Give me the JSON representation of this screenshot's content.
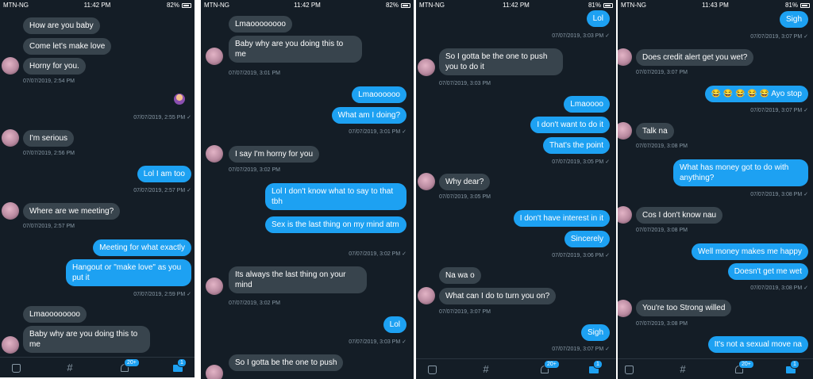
{
  "status_bars": [
    {
      "carrier": "MTN-NG",
      "time": "11:42 PM",
      "battery": "82%"
    },
    {
      "carrier": "MTN-NG",
      "time": "11:42 PM",
      "battery": "82%"
    },
    {
      "carrier": "MTN-NG",
      "time": "11:42 PM",
      "battery": "81%"
    },
    {
      "carrier": "MTN-NG",
      "time": "11:43 PM",
      "battery": "81%"
    }
  ],
  "badges": {
    "notifications": "20+",
    "messages": "1"
  },
  "panels": [
    {
      "messages": [
        {
          "dir": "in",
          "text": "How are you baby"
        },
        {
          "dir": "in",
          "text": "Come let's make love"
        },
        {
          "dir": "in",
          "text": "Horny for you."
        },
        {
          "meta": "07/07/2019, 2:54 PM"
        },
        {
          "meta": "07/07/2019, 2:55 PM ✓"
        },
        {
          "dir": "in",
          "text": "I'm serious"
        },
        {
          "meta": "07/07/2019, 2:56 PM"
        },
        {
          "dir": "out",
          "text": "Lol I am too"
        },
        {
          "meta": "07/07/2019, 2:57 PM ✓"
        },
        {
          "dir": "in",
          "text": "Where are we meeting?"
        },
        {
          "meta": "07/07/2019, 2:57 PM"
        },
        {
          "dir": "out",
          "text": "Meeting for what exactly"
        },
        {
          "dir": "out",
          "text": "Hangout or \"make love\" as you put it"
        },
        {
          "meta": "07/07/2019, 2:59 PM ✓"
        },
        {
          "dir": "in",
          "text": "Lmaoooooooo"
        },
        {
          "dir": "in",
          "text": "Baby why are you doing this to me"
        }
      ]
    },
    {
      "messages": [
        {
          "dir": "in",
          "text": "Lmaoooooooo"
        },
        {
          "dir": "in",
          "text": "Baby why are you doing this to me"
        },
        {
          "meta": "07/07/2019, 3:01 PM"
        },
        {
          "dir": "out",
          "text": "Lmaoooooo"
        },
        {
          "dir": "out",
          "text": "What am I doing?"
        },
        {
          "meta": "07/07/2019, 3:01 PM ✓"
        },
        {
          "dir": "in",
          "text": "I say I'm horny for you"
        },
        {
          "meta": "07/07/2019, 3:02 PM"
        },
        {
          "dir": "out",
          "text": "Lol I don't know what to say to that tbh"
        },
        {
          "dir": "out",
          "text": "Sex is the last thing on my mind atm"
        },
        {
          "meta": "07/07/2019, 3:02 PM ✓"
        },
        {
          "dir": "in",
          "text": "Its always the last thing on your mind"
        },
        {
          "meta": "07/07/2019, 3:02 PM"
        },
        {
          "dir": "out",
          "text": "Lol"
        },
        {
          "meta": "07/07/2019, 3:03 PM ✓"
        },
        {
          "dir": "in",
          "text": "So I gotta be the one to push"
        }
      ]
    },
    {
      "messages": [
        {
          "dir": "out",
          "text": "Lol"
        },
        {
          "meta": "07/07/2019, 3:03 PM ✓"
        },
        {
          "dir": "in",
          "text": "So I gotta be the one to push you to do it"
        },
        {
          "meta": "07/07/2019, 3:03 PM"
        },
        {
          "dir": "out",
          "text": "Lmaoooo"
        },
        {
          "dir": "out",
          "text": "I don't want to do it"
        },
        {
          "dir": "out",
          "text": "That's the point"
        },
        {
          "meta": "07/07/2019, 3:05 PM ✓"
        },
        {
          "dir": "in",
          "text": "Why dear?"
        },
        {
          "meta": "07/07/2019, 3:05 PM"
        },
        {
          "dir": "out",
          "text": "I don't have interest in it"
        },
        {
          "dir": "out",
          "text": "Sincerely"
        },
        {
          "meta": "07/07/2019, 3:06 PM ✓"
        },
        {
          "dir": "in",
          "text": "Na wa o"
        },
        {
          "dir": "in",
          "text": "What can I do to turn you on?"
        },
        {
          "meta": "07/07/2019, 3:07 PM"
        },
        {
          "dir": "out",
          "text": "Sigh"
        },
        {
          "meta": "07/07/2019, 3:07 PM ✓"
        }
      ]
    },
    {
      "messages": [
        {
          "dir": "out",
          "text": "Sigh"
        },
        {
          "meta": "07/07/2019, 3:07 PM ✓"
        },
        {
          "dir": "in",
          "text": "Does credit alert get you wet?"
        },
        {
          "meta": "07/07/2019, 3:07 PM"
        },
        {
          "dir": "out",
          "text": "😂 😂 😂 😂 😂 Ayo stop"
        },
        {
          "meta": "07/07/2019, 3:07 PM ✓"
        },
        {
          "dir": "in",
          "text": "Talk na"
        },
        {
          "meta": "07/07/2019, 3:08 PM"
        },
        {
          "dir": "out",
          "text": "What has money got to do with anything?"
        },
        {
          "meta": "07/07/2019, 3:08 PM ✓"
        },
        {
          "dir": "in",
          "text": "Cos I don't know nau"
        },
        {
          "meta": "07/07/2019, 3:08 PM"
        },
        {
          "dir": "out",
          "text": "Well money makes me happy"
        },
        {
          "dir": "out",
          "text": "Doesn't get me wet"
        },
        {
          "meta": "07/07/2019, 3:08 PM ✓"
        },
        {
          "dir": "in",
          "text": "You're too Strong willed"
        },
        {
          "meta": "07/07/2019, 3:08 PM"
        },
        {
          "dir": "out",
          "text": "It's not a sexual move na"
        }
      ]
    }
  ]
}
